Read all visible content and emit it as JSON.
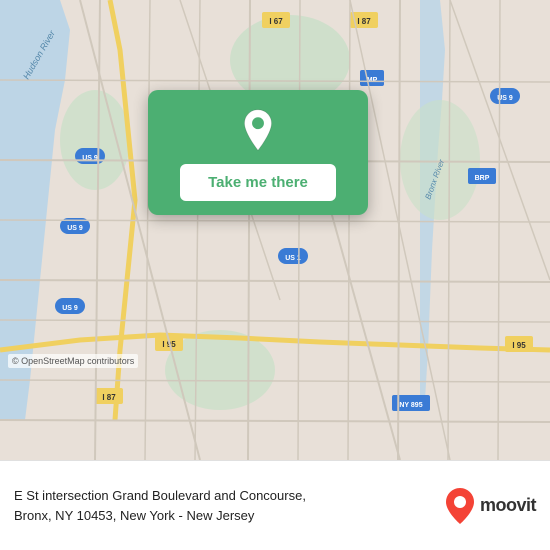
{
  "map": {
    "copyright": "© OpenStreetMap contributors"
  },
  "card": {
    "button_label": "Take me there"
  },
  "info": {
    "address": "E St intersection Grand Boulevard and Concourse,",
    "city_state": "Bronx, NY 10453, New York - New Jersey"
  },
  "branding": {
    "name": "moovit"
  },
  "colors": {
    "green": "#4CAF72",
    "white": "#ffffff"
  },
  "icons": {
    "pin": "location-pin-icon",
    "moovit_pin": "moovit-pin-icon"
  }
}
